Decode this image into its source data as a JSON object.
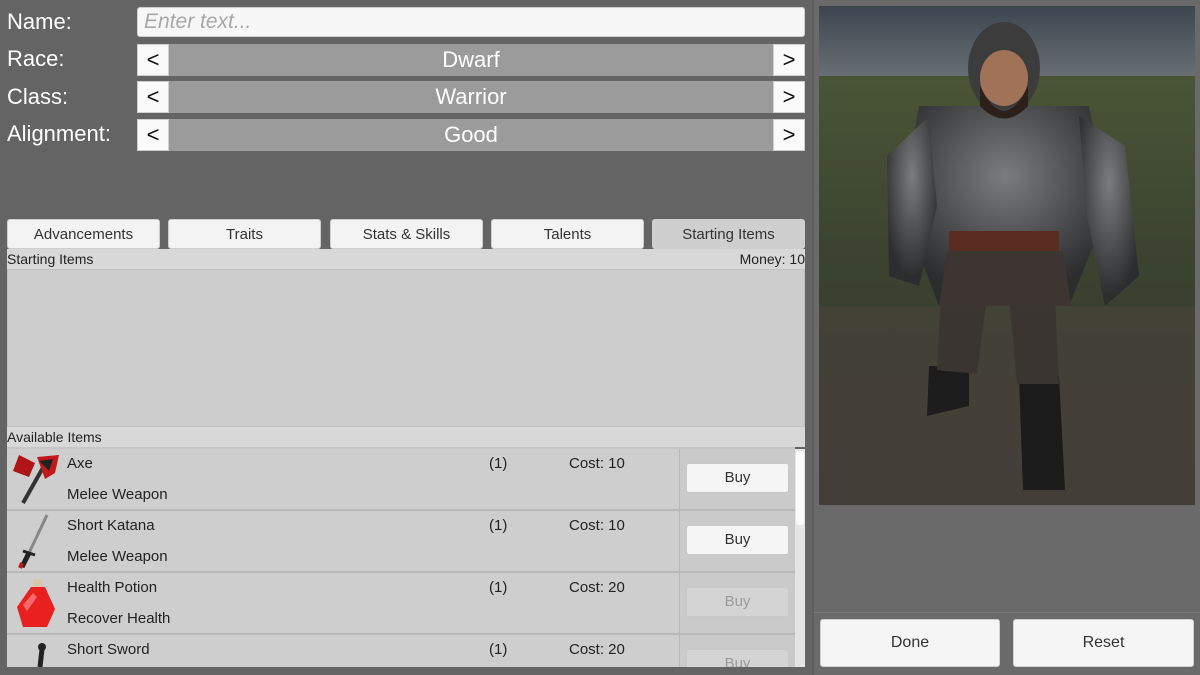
{
  "form": {
    "name_label": "Name:",
    "name_placeholder": "Enter text...",
    "name_value": "",
    "race_label": "Race:",
    "race_value": "Dwarf",
    "class_label": "Class:",
    "class_value": "Warrior",
    "alignment_label": "Alignment:",
    "alignment_value": "Good",
    "prev_symbol": "<",
    "next_symbol": ">"
  },
  "tabs": [
    {
      "label": "Advancements",
      "active": false
    },
    {
      "label": "Traits",
      "active": false
    },
    {
      "label": "Stats & Skills",
      "active": false
    },
    {
      "label": "Talents",
      "active": false
    },
    {
      "label": "Starting Items",
      "active": true
    }
  ],
  "starting_items": {
    "title": "Starting Items",
    "money": "Money: 10"
  },
  "available_items": {
    "title": "Available Items",
    "items": [
      {
        "name": "Axe",
        "type": "Melee Weapon",
        "qty": "(1)",
        "cost": "Cost: 10",
        "buy": "Buy",
        "icon": "axe-icon"
      },
      {
        "name": "Short Katana",
        "type": "Melee Weapon",
        "qty": "(1)",
        "cost": "Cost: 10",
        "buy": "Buy",
        "icon": "katana-icon"
      },
      {
        "name": "Health Potion",
        "type": "Recover Health",
        "qty": "(1)",
        "cost": "Cost: 20",
        "buy": "Buy",
        "icon": "potion-icon"
      },
      {
        "name": "Short Sword",
        "type": "",
        "qty": "(1)",
        "cost": "Cost: 20",
        "buy": "Buy",
        "icon": "sword-icon"
      }
    ]
  },
  "actions": {
    "done": "Done",
    "reset": "Reset"
  },
  "colors": {
    "panel_bg": "#646464",
    "selector_bg": "#9b9b9b",
    "list_bg": "#cecece"
  }
}
